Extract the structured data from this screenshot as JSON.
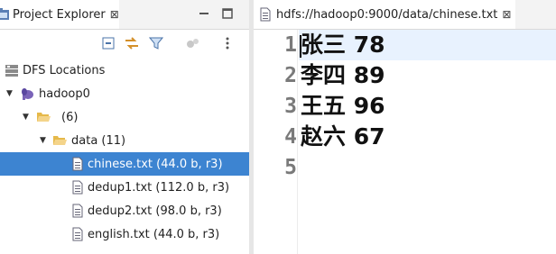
{
  "view": {
    "tab_label": "Project Explorer",
    "close_glyph": "⊠"
  },
  "tree": {
    "root": "DFS Locations",
    "host": "hadoop0",
    "unnamed_folder": "(6)",
    "data_folder": "data (11)",
    "files": [
      "chinese.txt (44.0 b, r3)",
      "dedup1.txt (112.0 b, r3)",
      "dedup2.txt (98.0 b, r3)",
      "english.txt (44.0 b, r3)"
    ],
    "selected_index": 0
  },
  "editor": {
    "tab_label": "hdfs://hadoop0:9000/data/chinese.txt",
    "close_glyph": "⊠",
    "line_numbers": [
      "1",
      "2",
      "3",
      "4",
      "5"
    ],
    "lines": [
      "张三 78",
      "李四 89",
      "王五 96",
      "赵六 67",
      ""
    ]
  },
  "colors": {
    "selection": "#3d84d1",
    "current_line": "#e8f2fe",
    "folder": "#e6b94a"
  }
}
